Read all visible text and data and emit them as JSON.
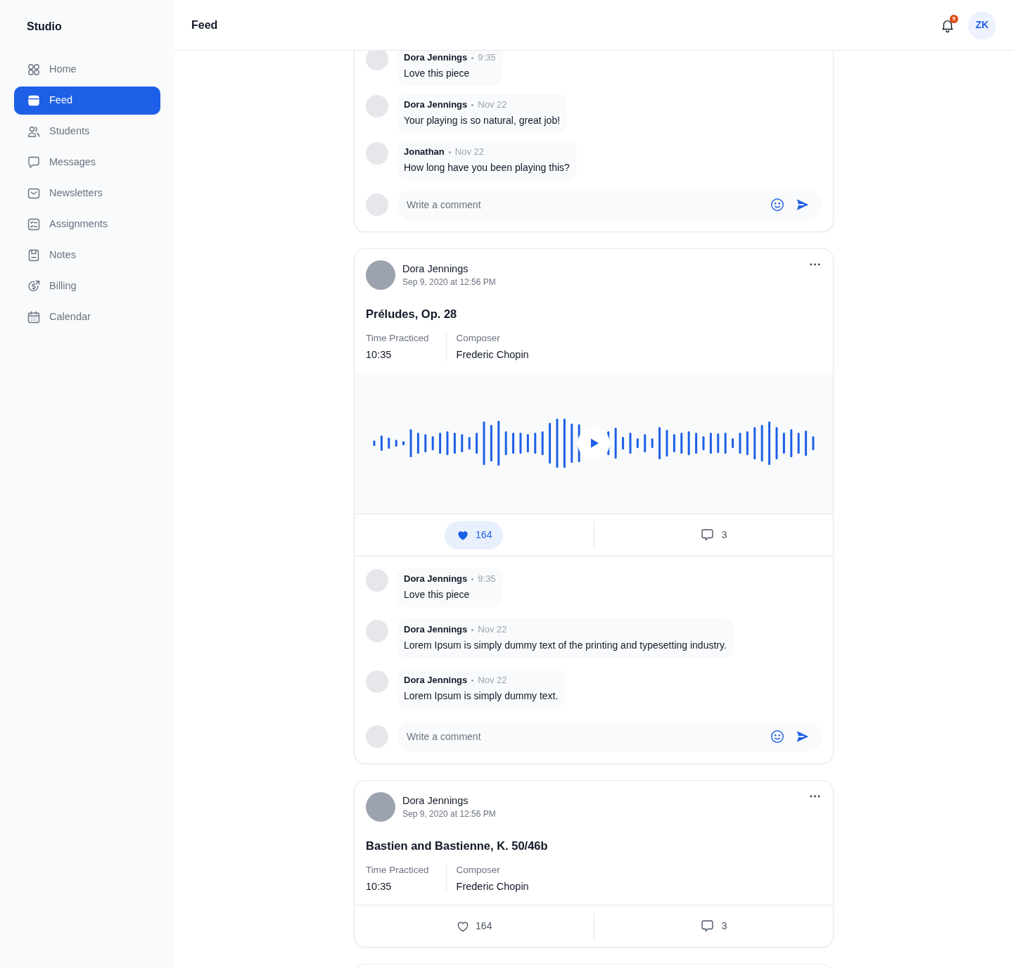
{
  "sidebar": {
    "brand": "Studio",
    "items": [
      {
        "label": "Home",
        "selected": false
      },
      {
        "label": "Feed",
        "selected": true
      },
      {
        "label": "Students",
        "selected": false
      },
      {
        "label": "Messages",
        "selected": false
      },
      {
        "label": "Newsletters",
        "selected": false
      },
      {
        "label": "Assignments",
        "selected": false
      },
      {
        "label": "Notes",
        "selected": false
      },
      {
        "label": "Billing",
        "selected": false
      },
      {
        "label": "Calendar",
        "selected": false
      }
    ]
  },
  "header": {
    "title": "Feed",
    "notification_count": "5",
    "user_initials": "ZK"
  },
  "posts": [
    {
      "comments": [
        {
          "author": "Dora Jennings",
          "time": "9:35",
          "text": "Love this piece"
        },
        {
          "author": "Dora Jennings",
          "time": "Nov 22",
          "text": "Your playing is so natural, great job!"
        },
        {
          "author": "Jonathan",
          "time": "Nov 22",
          "text": "How long have you been playing this?"
        }
      ],
      "comment_placeholder": "Write a comment"
    },
    {
      "author": "Dora Jennings",
      "date": "Sep 9, 2020 at 12:56 PM",
      "title": "Préludes, Op. 28",
      "fields": [
        {
          "label": "Time Practiced",
          "value": "10:35"
        },
        {
          "label": "Composer",
          "value": "Frederic Chopin"
        }
      ],
      "recording": true,
      "likes": "164",
      "liked": true,
      "comment_count": "3",
      "comments": [
        {
          "author": "Dora Jennings",
          "time": "9:35",
          "text": "Love this piece"
        },
        {
          "author": "Dora Jennings",
          "time": "Nov 22",
          "text": "Lorem Ipsum is simply dummy text of the printing and typesetting industry."
        },
        {
          "author": "Dora Jennings",
          "time": "Nov 22",
          "text": "Lorem Ipsum is simply dummy text."
        }
      ],
      "comment_placeholder": "Write a comment"
    },
    {
      "author": "Dora Jennings",
      "date": "Sep 9, 2020 at 12:56 PM",
      "title": "Bastien and Bastienne, K. 50/46b",
      "fields": [
        {
          "label": "Time Practiced",
          "value": "10:35"
        },
        {
          "label": "Composer",
          "value": "Frederic Chopin"
        }
      ],
      "recording": false,
      "likes": "164",
      "liked": false,
      "comment_count": "3"
    }
  ]
}
